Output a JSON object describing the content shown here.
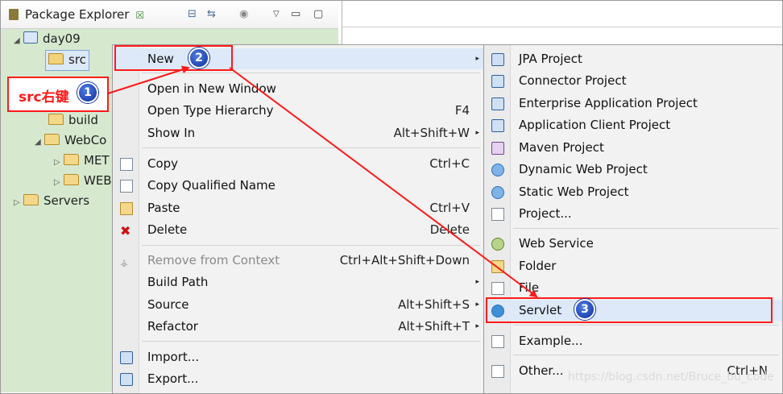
{
  "explorer": {
    "title": "Package Explorer",
    "close_glyph": "☒",
    "toolbar_icons": [
      "collapse-all-icon",
      "link-with-editor-icon",
      "focus-icon",
      "view-menu-icon",
      "minimize-icon",
      "maximize-icon"
    ],
    "tree": [
      {
        "label": "day09",
        "expander": "◢",
        "icon": "project-icon"
      },
      {
        "label": "src",
        "icon": "source-folder-icon"
      },
      {
        "label": "build",
        "icon": "folder-icon"
      },
      {
        "label": "WebCo",
        "expander": "◢",
        "icon": "folder-icon"
      },
      {
        "label": "MET",
        "expander": "▷",
        "icon": "folder-icon"
      },
      {
        "label": "WEB",
        "expander": "▷",
        "icon": "folder-icon"
      },
      {
        "label": "Servers",
        "expander": "▷",
        "icon": "folder-icon"
      }
    ]
  },
  "context_menu": {
    "items": [
      {
        "label": "New",
        "accel": "",
        "submenu": "▸"
      },
      {
        "label": "Open in New Window",
        "accel": ""
      },
      {
        "label": "Open Type Hierarchy",
        "accel": "F4"
      },
      {
        "label": "Show In",
        "accel": "Alt+Shift+W",
        "submenu": "▸"
      },
      {
        "label": "Copy",
        "accel": "Ctrl+C",
        "icon": "copy-icon"
      },
      {
        "label": "Copy Qualified Name",
        "accel": "",
        "icon": "copy-qualified-name-icon"
      },
      {
        "label": "Paste",
        "accel": "Ctrl+V",
        "icon": "paste-icon"
      },
      {
        "label": "Delete",
        "accel": "Delete",
        "icon": "delete-icon"
      },
      {
        "label": "Remove from Context",
        "accel": "Ctrl+Alt+Shift+Down",
        "icon": "remove-context-icon",
        "disabled": true
      },
      {
        "label": "Build Path",
        "accel": "",
        "submenu": "▸"
      },
      {
        "label": "Source",
        "accel": "Alt+Shift+S",
        "submenu": "▸"
      },
      {
        "label": "Refactor",
        "accel": "Alt+Shift+T",
        "submenu": "▸"
      },
      {
        "label": "Import...",
        "accel": "",
        "icon": "import-icon"
      },
      {
        "label": "Export...",
        "accel": "",
        "icon": "export-icon"
      }
    ]
  },
  "new_submenu": {
    "items": [
      {
        "label": "JPA Project",
        "icon": "jpa-project-icon"
      },
      {
        "label": "Connector Project",
        "icon": "connector-project-icon"
      },
      {
        "label": "Enterprise Application Project",
        "icon": "enterprise-application-icon"
      },
      {
        "label": "Application Client Project",
        "icon": "application-client-icon"
      },
      {
        "label": "Maven Project",
        "icon": "maven-project-icon"
      },
      {
        "label": "Dynamic Web Project",
        "icon": "dynamic-web-project-icon"
      },
      {
        "label": "Static Web Project",
        "icon": "static-web-project-icon"
      },
      {
        "label": "Project...",
        "icon": "project-icon"
      },
      {
        "label": "Web Service",
        "icon": "web-service-icon"
      },
      {
        "label": "Folder",
        "icon": "folder-icon"
      },
      {
        "label": "File",
        "icon": "file-icon"
      },
      {
        "label": "Servlet",
        "icon": "servlet-icon"
      },
      {
        "label": "Example...",
        "icon": "example-icon"
      },
      {
        "label": "Other...",
        "accel": "Ctrl+N",
        "icon": "other-icon"
      }
    ]
  },
  "annotations": {
    "step1_note": "src右键",
    "badges": [
      "1",
      "2",
      "3"
    ],
    "color": "#ff1a1a"
  },
  "watermark": "https://blog.csdn.net/Bruce_bu_code"
}
